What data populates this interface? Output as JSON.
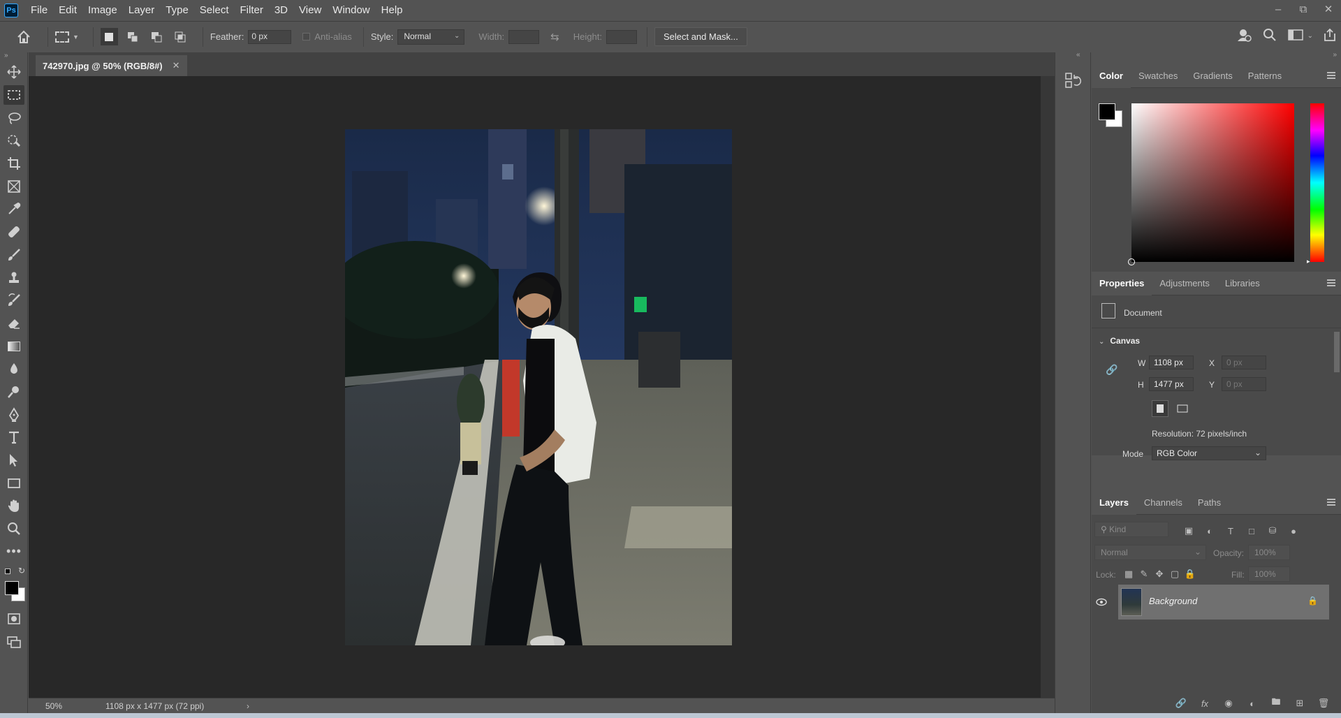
{
  "app": {
    "logo": "Ps"
  },
  "menu": [
    "File",
    "Edit",
    "Image",
    "Layer",
    "Type",
    "Select",
    "Filter",
    "3D",
    "View",
    "Window",
    "Help"
  ],
  "window_controls": [
    "minimize-icon",
    "restore-icon",
    "close-icon"
  ],
  "options": {
    "feather_label": "Feather:",
    "feather_value": "0 px",
    "antialias_label": "Anti-alias",
    "style_label": "Style:",
    "style_value": "Normal",
    "width_label": "Width:",
    "height_label": "Height:",
    "select_mask_label": "Select and Mask..."
  },
  "document": {
    "tab_title": "742970.jpg @ 50% (RGB/8#)",
    "zoom": "50%",
    "info": "1108 px x 1477 px (72 ppi)"
  },
  "color_panel": {
    "tabs": [
      "Color",
      "Swatches",
      "Gradients",
      "Patterns"
    ],
    "foreground": "#000000",
    "background": "#ffffff"
  },
  "properties_panel": {
    "tabs": [
      "Properties",
      "Adjustments",
      "Libraries"
    ],
    "type_label": "Document",
    "section": "Canvas",
    "w_label": "W",
    "w_value": "1108 px",
    "h_label": "H",
    "h_value": "1477 px",
    "x_label": "X",
    "x_placeholder": "0 px",
    "y_label": "Y",
    "y_placeholder": "0 px",
    "resolution": "Resolution: 72 pixels/inch",
    "mode_label": "Mode",
    "mode_value": "RGB Color"
  },
  "layers_panel": {
    "tabs": [
      "Layers",
      "Channels",
      "Paths"
    ],
    "filter_placeholder": "Kind",
    "blend_mode": "Normal",
    "opacity_label": "Opacity:",
    "opacity_value": "100%",
    "lock_label": "Lock:",
    "fill_label": "Fill:",
    "fill_value": "100%",
    "layers": [
      {
        "name": "Background",
        "visible": true,
        "locked": true
      }
    ]
  },
  "colors": {
    "ui_bg": "#535353",
    "canvas_bg": "#282828",
    "accent": "#31a8ff"
  }
}
